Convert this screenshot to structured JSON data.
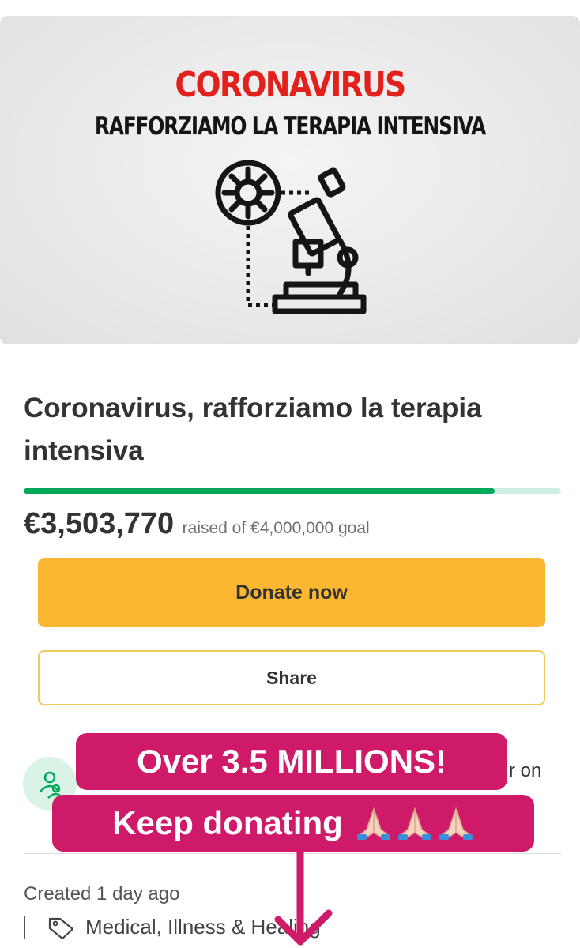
{
  "hero": {
    "headline": "CORONAVIRUS",
    "subheadline": "RAFFORZIAMO LA TERAPIA INTENSIVA",
    "illustration": "virus-microscope-icon"
  },
  "campaign": {
    "title": "Coronavirus, rafforziamo la terapia intensiva",
    "raised": "€3,503,770",
    "goal_text": "raised of €4,000,000 goal",
    "progress_fraction": 0.876
  },
  "actions": {
    "donate_label": "Donate now",
    "share_label": "Share"
  },
  "organizer": {
    "avatar_icon": "person-group-icon",
    "text_tail": "r on"
  },
  "details": {
    "created": "Created 1 day ago",
    "category_icon": "tag-icon",
    "category": "Medical, Illness & Healing"
  },
  "overlay": {
    "line1": "Over 3.5 MILLIONS!",
    "line2": "Keep donating",
    "emoji": "praying-hands-icon",
    "arrow": "arrow-down-icon"
  },
  "colors": {
    "brand_green": "#02a95c",
    "donate_yellow": "#fbb731",
    "headline_red": "#e3211c",
    "sticker_pink": "#cf1a6a"
  }
}
